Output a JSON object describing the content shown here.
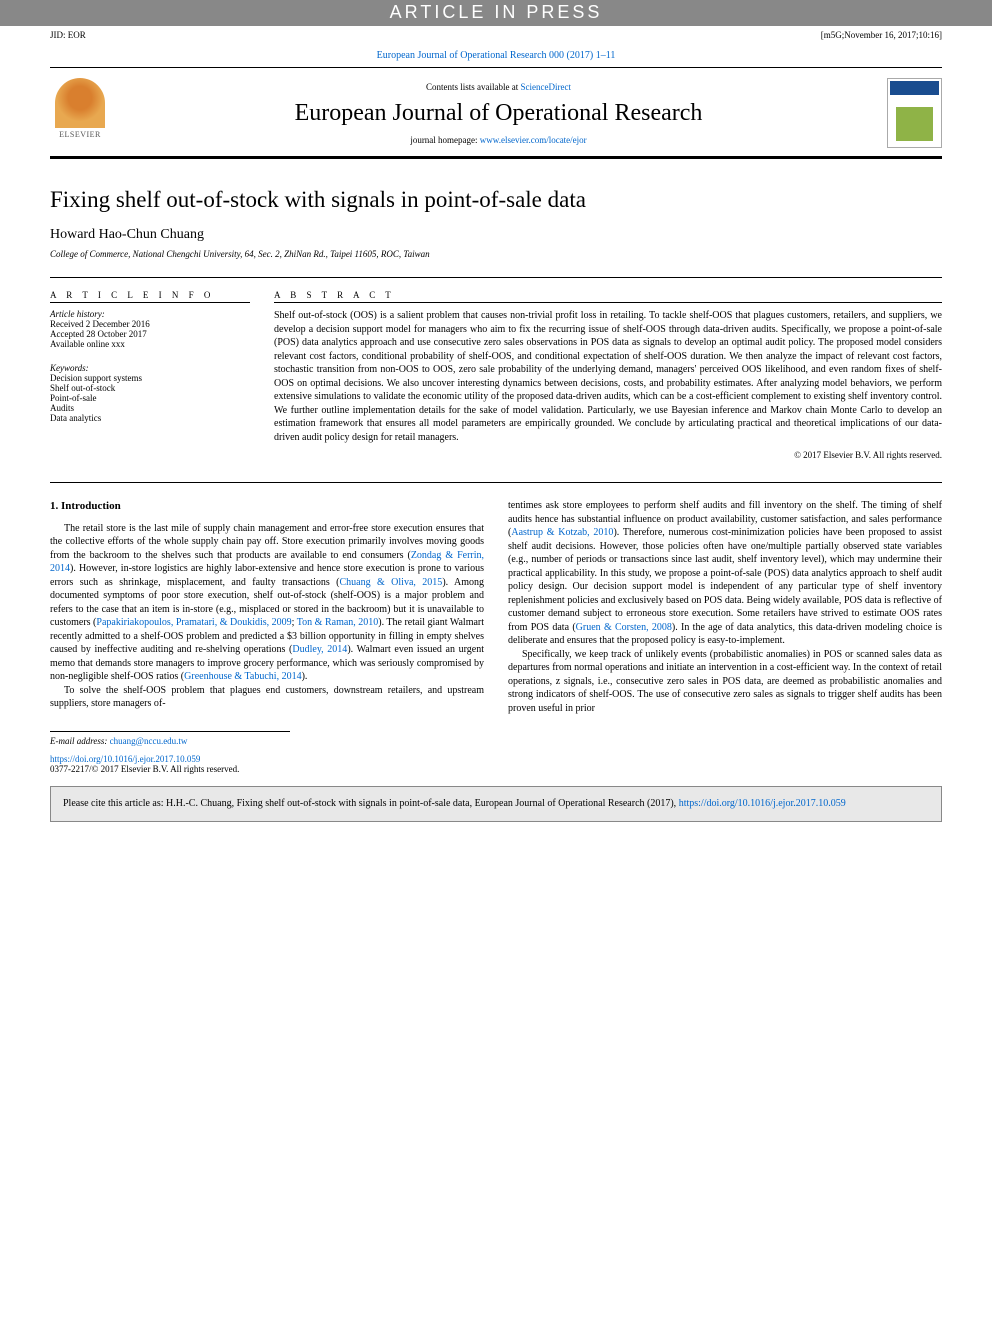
{
  "banner": {
    "press": "ARTICLE IN PRESS"
  },
  "header": {
    "jid": "JID: EOR",
    "stamp": "[m5G;November 16, 2017;10:16]"
  },
  "journal": {
    "citation_prefix": "European Journal of Operational Research 000 (2017) 1–11",
    "contents": "Contents lists available at ",
    "contents_link": "ScienceDirect",
    "name": "European Journal of Operational Research",
    "homepage_label": "journal homepage: ",
    "homepage_url": "www.elsevier.com/locate/ejor",
    "publisher": "ELSEVIER"
  },
  "title": "Fixing shelf out-of-stock with signals in point-of-sale data",
  "author": "Howard Hao-Chun Chuang",
  "affiliation": "College of Commerce, National Chengchi University, 64, Sec. 2, ZhiNan Rd., Taipei 11605, ROC, Taiwan",
  "info": {
    "heading": "a r t i c l e   i n f o",
    "history_label": "Article history:",
    "received": "Received 2 December 2016",
    "accepted": "Accepted 28 October 2017",
    "online": "Available online xxx",
    "keywords_label": "Keywords:",
    "keywords": [
      "Decision support systems",
      "Shelf out-of-stock",
      "Point-of-sale",
      "Audits",
      "Data analytics"
    ]
  },
  "abstract": {
    "heading": "a b s t r a c t",
    "text": "Shelf out-of-stock (OOS) is a salient problem that causes non-trivial profit loss in retailing. To tackle shelf-OOS that plagues customers, retailers, and suppliers, we develop a decision support model for managers who aim to fix the recurring issue of shelf-OOS through data-driven audits. Specifically, we propose a point-of-sale (POS) data analytics approach and use consecutive zero sales observations in POS data as signals to develop an optimal audit policy. The proposed model considers relevant cost factors, conditional probability of shelf-OOS, and conditional expectation of shelf-OOS duration. We then analyze the impact of relevant cost factors, stochastic transition from non-OOS to OOS, zero sale probability of the underlying demand, managers' perceived OOS likelihood, and even random fixes of shelf-OOS on optimal decisions. We also uncover interesting dynamics between decisions, costs, and probability estimates. After analyzing model behaviors, we perform extensive simulations to validate the economic utility of the proposed data-driven audits, which can be a cost-efficient complement to existing shelf inventory control. We further outline implementation details for the sake of model validation. Particularly, we use Bayesian inference and Markov chain Monte Carlo to develop an estimation framework that ensures all model parameters are empirically grounded. We conclude by articulating practical and theoretical implications of our data-driven audit policy design for retail managers.",
    "copyright": "© 2017 Elsevier B.V. All rights reserved."
  },
  "body": {
    "section1_heading": "1. Introduction",
    "col1_p1a": "The retail store is the last mile of supply chain management and error-free store execution ensures that the collective efforts of the whole supply chain pay off. Store execution primarily involves moving goods from the backroom to the shelves such that products are available to end consumers (",
    "ref1": "Zondag & Ferrin, 2014",
    "col1_p1b": "). However, in-store logistics are highly labor-extensive and hence store execution is prone to various errors such as shrinkage, misplacement, and faulty transactions (",
    "ref2": "Chuang & Oliva, 2015",
    "col1_p1c": "). Among documented symptoms of poor store execution, shelf out-of-stock (shelf-OOS) is a major problem and refers to the case that an item is in-store (e.g., misplaced or stored in the backroom) but it is unavailable to customers (",
    "ref3": "Papakiriakopoulos, Pramatari, & Doukidis, 2009",
    "ref3b": "Ton & Raman, 2010",
    "col1_p1d": "). The retail giant Walmart recently admitted to a shelf-OOS problem and predicted a $3 billion opportunity in filling in empty shelves caused by ineffective auditing and re-shelving operations (",
    "ref4": "Dudley, 2014",
    "col1_p1e": "). Walmart even issued an urgent memo that demands store managers to improve grocery performance, which was seriously compromised by non-negligible shelf-OOS ratios (",
    "ref5": "Greenhouse & Tabuchi, 2014",
    "col1_p1f": ").",
    "col1_p2": "To solve the shelf-OOS problem that plagues end customers, downstream retailers, and upstream suppliers, store managers of-",
    "col2_p1a": "tentimes ask store employees to perform shelf audits and fill inventory on the shelf. The timing of shelf audits hence has substantial influence on product availability, customer satisfaction, and sales performance (",
    "ref6": "Aastrup & Kotzab, 2010",
    "col2_p1b": "). Therefore, numerous cost-minimization policies have been proposed to assist shelf audit decisions. However, those policies often have one/multiple partially observed state variables (e.g., number of periods or transactions since last audit, shelf inventory level), which may undermine their practical applicability. In this study, we propose a point-of-sale (POS) data analytics approach to shelf audit policy design. Our decision support model is independent of any particular type of shelf inventory replenishment policies and exclusively based on POS data. Being widely available, POS data is reflective of customer demand subject to erroneous store execution. Some retailers have strived to estimate OOS rates from POS data (",
    "ref7": "Gruen & Corsten, 2008",
    "col2_p1c": "). In the age of data analytics, this data-driven modeling choice is deliberate and ensures that the proposed policy is easy-to-implement.",
    "col2_p2": "Specifically, we keep track of unlikely events (probabilistic anomalies) in POS or scanned sales data as departures from normal operations and initiate an intervention in a cost-efficient way. In the context of retail operations, z signals, i.e., consecutive zero sales in POS data, are deemed as probabilistic anomalies and strong indicators of shelf-OOS. The use of consecutive zero sales as signals to trigger shelf audits has been proven useful in prior"
  },
  "email": {
    "label": "E-mail address: ",
    "address": "chuang@nccu.edu.tw"
  },
  "doi": {
    "url": "https://doi.org/10.1016/j.ejor.2017.10.059",
    "issn": "0377-2217/© 2017 Elsevier B.V. All rights reserved."
  },
  "cite": {
    "prefix": "Please cite this article as: H.H.-C. Chuang, Fixing shelf out-of-stock with signals in point-of-sale data, European Journal of Operational Research (2017), ",
    "url": "https://doi.org/10.1016/j.ejor.2017.10.059"
  }
}
